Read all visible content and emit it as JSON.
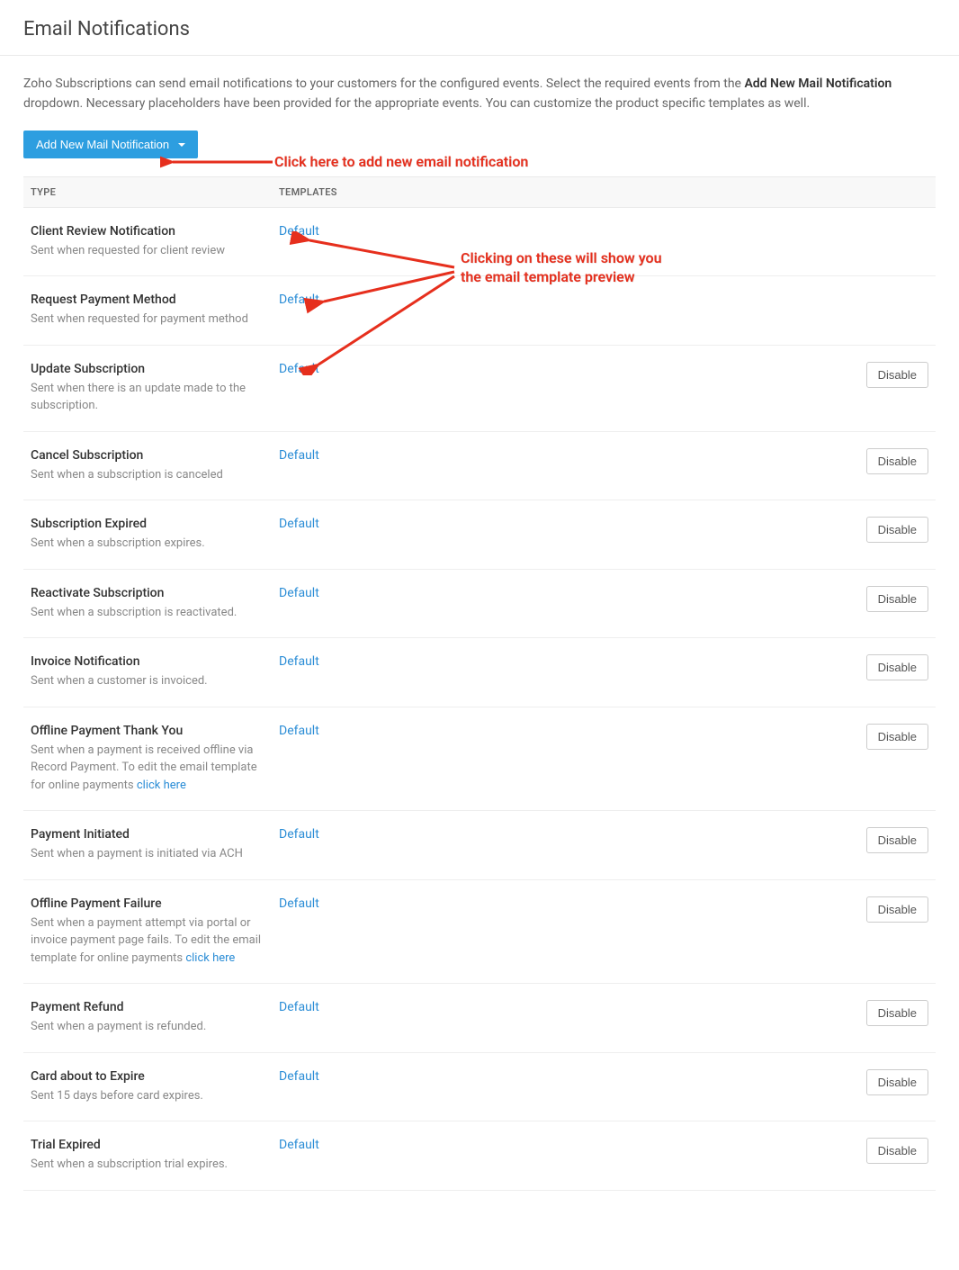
{
  "header": {
    "title": "Email Notifications"
  },
  "intro": {
    "part1": "Zoho Subscriptions can send email notifications to your customers for the configured events. Select the required events from the ",
    "bold": "Add New Mail Notification",
    "part2": " dropdown. Necessary placeholders have been provided for the appropriate events. You can customize the product specific templates as well."
  },
  "add_button": {
    "label": "Add New Mail Notification"
  },
  "columns": {
    "type": "TYPE",
    "templates": "TEMPLATES"
  },
  "action_label": "Disable",
  "annotations": {
    "add_hint": "Click here to add new email notification",
    "template_hint_line1": "Clicking on these will show you",
    "template_hint_line2": "the email template preview"
  },
  "rows": [
    {
      "title": "Client Review Notification",
      "desc": "Sent when requested for client review",
      "template": "Default",
      "has_action": false
    },
    {
      "title": "Request Payment Method",
      "desc": "Sent when requested for payment method",
      "template": "Default",
      "has_action": false
    },
    {
      "title": "Update Subscription",
      "desc": "Sent when there is an update made to the subscription.",
      "template": "Default",
      "has_action": true
    },
    {
      "title": "Cancel Subscription",
      "desc": "Sent when a subscription is canceled",
      "template": "Default",
      "has_action": true
    },
    {
      "title": "Subscription Expired",
      "desc": "Sent when a subscription expires.",
      "template": "Default",
      "has_action": true
    },
    {
      "title": "Reactivate Subscription",
      "desc": "Sent when a subscription is reactivated.",
      "template": "Default",
      "has_action": true
    },
    {
      "title": "Invoice Notification",
      "desc": "Sent when a customer is invoiced.",
      "template": "Default",
      "has_action": true
    },
    {
      "title": "Offline Payment Thank You",
      "desc": "Sent when a payment is received offline via Record Payment. To edit the email template for online payments ",
      "template": "Default",
      "has_action": true,
      "inline_link": "click here"
    },
    {
      "title": "Payment Initiated",
      "desc": "Sent when a payment is initiated via ACH",
      "template": "Default",
      "has_action": true
    },
    {
      "title": "Offline Payment Failure",
      "desc": "Sent when a payment attempt via portal or invoice payment page fails. To edit the email template for online payments ",
      "template": "Default",
      "has_action": true,
      "inline_link": "click here"
    },
    {
      "title": "Payment Refund",
      "desc": "Sent when a payment is refunded.",
      "template": "Default",
      "has_action": true
    },
    {
      "title": "Card about to Expire",
      "desc": "Sent 15 days before card expires.",
      "template": "Default",
      "has_action": true
    },
    {
      "title": "Trial Expired",
      "desc": "Sent when a subscription trial expires.",
      "template": "Default",
      "has_action": true
    }
  ]
}
